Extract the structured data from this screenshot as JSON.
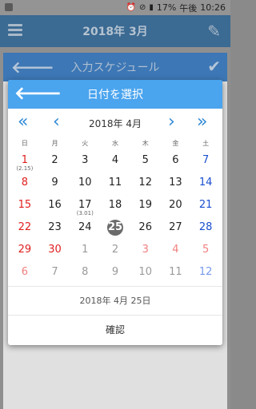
{
  "status_bar": {
    "battery": "17%",
    "period": "午後",
    "time": "10:26"
  },
  "background": {
    "title": "2018年 3月"
  },
  "sheet": {
    "title": "入力スケジュール"
  },
  "dialog": {
    "title": "日付を選択",
    "month_label": "2018年 4月",
    "weekdays": [
      "日",
      "月",
      "火",
      "水",
      "木",
      "金",
      "土"
    ],
    "days": [
      {
        "d": "1",
        "sub": "(2.15)",
        "type": "sun"
      },
      {
        "d": "2"
      },
      {
        "d": "3"
      },
      {
        "d": "4"
      },
      {
        "d": "5"
      },
      {
        "d": "6"
      },
      {
        "d": "7",
        "type": "sat"
      },
      {
        "d": "8",
        "type": "sun"
      },
      {
        "d": "9"
      },
      {
        "d": "10"
      },
      {
        "d": "11"
      },
      {
        "d": "12"
      },
      {
        "d": "13"
      },
      {
        "d": "14",
        "type": "sat"
      },
      {
        "d": "15",
        "type": "sun"
      },
      {
        "d": "16"
      },
      {
        "d": "17",
        "sub": "(3.01)"
      },
      {
        "d": "18"
      },
      {
        "d": "19"
      },
      {
        "d": "20"
      },
      {
        "d": "21",
        "type": "sat"
      },
      {
        "d": "22",
        "type": "sun"
      },
      {
        "d": "23"
      },
      {
        "d": "24"
      },
      {
        "d": "25",
        "selected": true
      },
      {
        "d": "26"
      },
      {
        "d": "27"
      },
      {
        "d": "28",
        "type": "sat"
      },
      {
        "d": "29",
        "type": "sun"
      },
      {
        "d": "30",
        "type": "sun"
      },
      {
        "d": "1",
        "dim": true
      },
      {
        "d": "2",
        "dim": true
      },
      {
        "d": "3",
        "dim": true,
        "type": "sun"
      },
      {
        "d": "4",
        "dim": true,
        "type": "sun"
      },
      {
        "d": "5",
        "dim": true,
        "type": "sun"
      },
      {
        "d": "6",
        "dim": true,
        "type": "sun"
      },
      {
        "d": "7",
        "dim": true
      },
      {
        "d": "8",
        "dim": true
      },
      {
        "d": "9",
        "dim": true
      },
      {
        "d": "10",
        "dim": true
      },
      {
        "d": "11",
        "dim": true
      },
      {
        "d": "12",
        "dim": true,
        "type": "sat"
      }
    ],
    "selected_date": "2018年 4月 25日",
    "confirm_label": "確認"
  }
}
